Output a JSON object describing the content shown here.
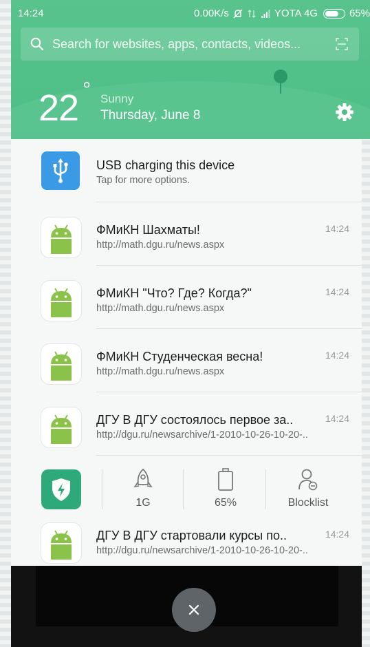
{
  "status": {
    "time": "14:24",
    "network_speed": "0.00K/s",
    "carrier": "YOTA 4G",
    "battery": "65%"
  },
  "search": {
    "placeholder": "Search for websites, apps, contacts, videos..."
  },
  "weather": {
    "temperature": "22",
    "degree": "°",
    "condition": "Sunny",
    "date": "Thursday, June 8"
  },
  "usb": {
    "title": "USB charging this device",
    "subtitle": "Tap for more options."
  },
  "notifications": [
    {
      "title": "ФМиКН Шахматы!",
      "url": "http://math.dgu.ru/news.aspx",
      "time": "14:24"
    },
    {
      "title": "ФМиКН \"Что? Где? Когда?\"",
      "url": "http://math.dgu.ru/news.aspx",
      "time": "14:24"
    },
    {
      "title": "ФМиКН Студенческая весна!",
      "url": "http://math.dgu.ru/news.aspx",
      "time": "14:24"
    },
    {
      "title": "ДГУ В ДГУ состоялось первое за..",
      "url": "http://dgu.ru/newsarchive/1-2010-10-26-10-20-..",
      "time": "14:24"
    },
    {
      "title": "ДГУ В ДГУ стартовали курсы по..",
      "url": "http://dgu.ru/newsarchive/1-2010-10-26-10-20-..",
      "time": "14:24"
    }
  ],
  "quick": {
    "memory": "1G",
    "battery": "65%",
    "blocklist": "Blocklist"
  },
  "colors": {
    "header_green": "#4dbd86",
    "usb_blue": "#3b9ae6",
    "android_green": "#8bc34a",
    "security_green": "#2ea979"
  },
  "icons": {
    "search": "search-icon",
    "scan": "scan-icon",
    "settings": "gear-icon",
    "usb": "usb-icon",
    "app": "android-icon",
    "security": "shield-icon",
    "memory": "rocket-icon",
    "battery": "battery-icon",
    "blocklist": "blocklist-icon",
    "close": "close-icon"
  }
}
